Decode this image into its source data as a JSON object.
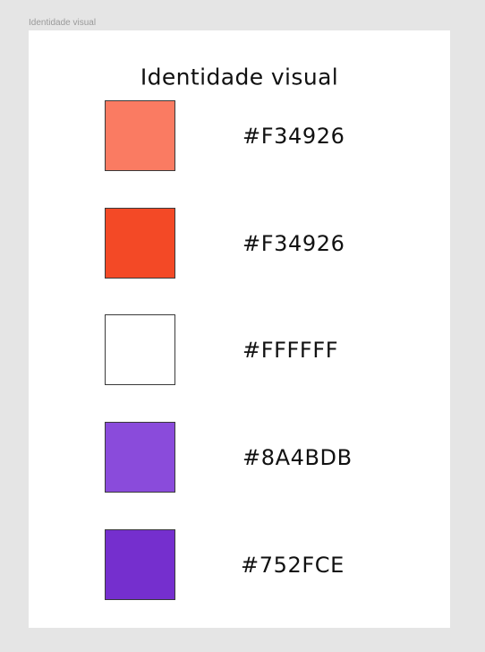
{
  "canvas": {
    "frame_label": "Identidade visual",
    "background_color": "#E5E5E5",
    "frame_color": "#FFFFFF"
  },
  "frame": {
    "title": "Identidade visual",
    "swatches": [
      {
        "hex_label": "#F34926",
        "fill_color": "#FA7B62"
      },
      {
        "hex_label": "#F34926",
        "fill_color": "#F34926"
      },
      {
        "hex_label": "#FFFFFF",
        "fill_color": "#FFFFFF"
      },
      {
        "hex_label": "#8A4BDB",
        "fill_color": "#8A4BDB"
      },
      {
        "hex_label": "#752FCE",
        "fill_color": "#752FCE"
      }
    ]
  }
}
